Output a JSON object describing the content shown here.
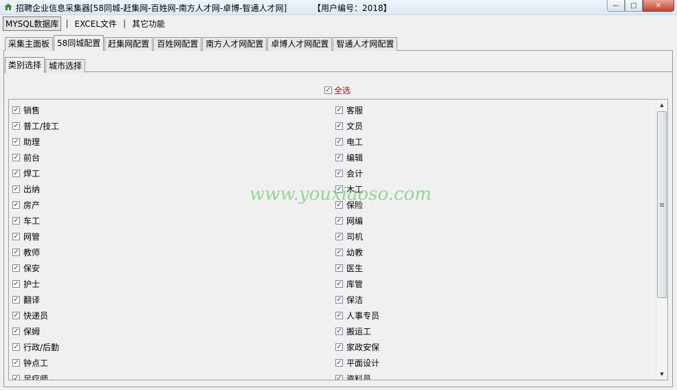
{
  "window": {
    "title": "招聘企业信息采集器[58同城-赶集网-百姓网-南方人才网-卓博-智通人才网]",
    "user_id": "【用户编号：2018】",
    "min_label": "—",
    "max_label": "□",
    "close_label": "✕"
  },
  "menu": [
    {
      "label": "MYSQL数据库",
      "active": true
    },
    {
      "label": "EXCEL文件",
      "active": false
    },
    {
      "label": "其它功能",
      "active": false
    }
  ],
  "menu_separator": "|",
  "outer_tabs": [
    {
      "label": "采集主面板",
      "selected": false
    },
    {
      "label": "58同城配置",
      "selected": true
    },
    {
      "label": "赶集网配置",
      "selected": false
    },
    {
      "label": "百姓网配置",
      "selected": false
    },
    {
      "label": "南方人才网配置",
      "selected": false
    },
    {
      "label": "卓博人才网配置",
      "selected": false
    },
    {
      "label": "智通人才网配置",
      "selected": false
    }
  ],
  "inner_tabs": [
    {
      "label": "类别选择",
      "selected": true
    },
    {
      "label": "城市选择",
      "selected": false
    }
  ],
  "select_all": {
    "label": "全选",
    "checked": true
  },
  "categories_left": [
    {
      "label": "销售",
      "checked": true
    },
    {
      "label": "普工/技工",
      "checked": true
    },
    {
      "label": "助理",
      "checked": true
    },
    {
      "label": "前台",
      "checked": true
    },
    {
      "label": "焊工",
      "checked": true
    },
    {
      "label": "出纳",
      "checked": true
    },
    {
      "label": "房产",
      "checked": true
    },
    {
      "label": "车工",
      "checked": true
    },
    {
      "label": "网管",
      "checked": true
    },
    {
      "label": "教师",
      "checked": true
    },
    {
      "label": "保安",
      "checked": true
    },
    {
      "label": "护士",
      "checked": true
    },
    {
      "label": "翻译",
      "checked": true
    },
    {
      "label": "快递员",
      "checked": true
    },
    {
      "label": "保姆",
      "checked": true
    },
    {
      "label": "行政/后勤",
      "checked": true
    },
    {
      "label": "钟点工",
      "checked": true
    },
    {
      "label": "足疗师",
      "checked": true
    }
  ],
  "categories_right": [
    {
      "label": "客服",
      "checked": true
    },
    {
      "label": "文员",
      "checked": true
    },
    {
      "label": "电工",
      "checked": true
    },
    {
      "label": "编辑",
      "checked": true
    },
    {
      "label": "会计",
      "checked": true
    },
    {
      "label": "木工",
      "checked": true
    },
    {
      "label": "保险",
      "checked": true
    },
    {
      "label": "网编",
      "checked": true
    },
    {
      "label": "司机",
      "checked": true
    },
    {
      "label": "幼教",
      "checked": true
    },
    {
      "label": "医生",
      "checked": true
    },
    {
      "label": "库管",
      "checked": true
    },
    {
      "label": "保洁",
      "checked": true
    },
    {
      "label": "人事专员",
      "checked": true
    },
    {
      "label": "搬运工",
      "checked": true
    },
    {
      "label": "家政安保",
      "checked": true
    },
    {
      "label": "平面设计",
      "checked": true
    },
    {
      "label": "资料员",
      "checked": true
    }
  ],
  "check_glyph": "✓",
  "watermark": "www.youxiaoso.com",
  "colors": {
    "select_all_label": "#d00000",
    "watermark": "#50c850"
  }
}
